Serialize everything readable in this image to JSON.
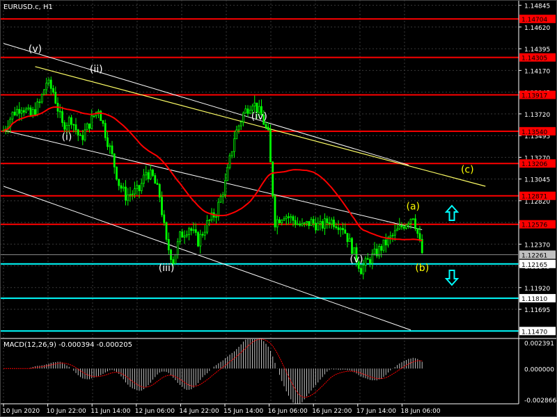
{
  "window": {
    "title": "EURUSD.c, H1"
  },
  "colors": {
    "background": "#000000",
    "grid": "#3a3a3a",
    "axis": "#ffffff",
    "bull_candle": "#00ff00",
    "bear_candle": "#00ff00",
    "support_line": "#ff0000",
    "support_label_bg": "#ff0000",
    "cyan_line": "#00ffff",
    "cyan_label_bg": "#ffffff",
    "ma": "#ff0000",
    "channel": "#ffffff",
    "trend": "#ffff66",
    "wave_white": "#ffffff",
    "wave_yellow": "#ffff00",
    "arrow": "#00ffff",
    "macd_hist": "#c0c0c0",
    "macd_signal": "#ff0000",
    "current_price_bg": "#c0c0c0"
  },
  "chart_data": [
    {
      "type": "candlestick",
      "title": "EURUSD.c, H1",
      "price_axis_ticks": [
        "1.14845",
        "1.14620",
        "1.14395",
        "1.14170",
        "1.13945",
        "1.13720",
        "1.13495",
        "1.13270",
        "1.13045",
        "1.12820",
        "1.12595",
        "1.12370",
        "1.12145",
        "1.11920",
        "1.11695"
      ],
      "ylim": [
        1.114,
        1.149
      ],
      "time_axis_ticks": [
        "10 Jun 2020",
        "10 Jun 22:00",
        "11 Jun 14:00",
        "12 Jun 06:00",
        "14 Jun 22:00",
        "15 Jun 14:00",
        "16 Jun 06:00",
        "16 Jun 22:00",
        "17 Jun 14:00",
        "18 Jun 06:00"
      ],
      "bar_count": 150,
      "close_path": [
        [
          0,
          1.1355
        ],
        [
          4,
          1.1372
        ],
        [
          8,
          1.138
        ],
        [
          12,
          1.137
        ],
        [
          16,
          1.1383
        ],
        [
          19,
          1.1405
        ],
        [
          22,
          1.1395
        ],
        [
          26,
          1.136
        ],
        [
          30,
          1.1367
        ],
        [
          34,
          1.1345
        ],
        [
          38,
          1.1362
        ],
        [
          42,
          1.1378
        ],
        [
          45,
          1.1352
        ],
        [
          48,
          1.1328
        ],
        [
          51,
          1.13
        ],
        [
          54,
          1.1287
        ],
        [
          57,
          1.129
        ],
        [
          60,
          1.1293
        ],
        [
          63,
          1.1312
        ],
        [
          66,
          1.1306
        ],
        [
          69,
          1.1287
        ],
        [
          72,
          1.1238
        ],
        [
          75,
          1.122
        ],
        [
          78,
          1.1245
        ],
        [
          82,
          1.1255
        ],
        [
          86,
          1.124
        ],
        [
          90,
          1.1258
        ],
        [
          94,
          1.127
        ],
        [
          98,
          1.13
        ],
        [
          102,
          1.1348
        ],
        [
          106,
          1.1372
        ],
        [
          110,
          1.1385
        ],
        [
          114,
          1.137
        ],
        [
          117,
          1.135
        ],
        [
          120,
          1.126
        ],
        [
          124,
          1.1268
        ],
        [
          128,
          1.1262
        ],
        [
          132,
          1.1255
        ],
        [
          136,
          1.126
        ],
        [
          140,
          1.1255
        ],
        [
          144,
          1.1262
        ],
        [
          148,
          1.1258
        ],
        [
          150,
          1.1255
        ]
      ],
      "horizontal_levels": [
        {
          "kind": "red",
          "value": 1.14704,
          "label": "1.14704"
        },
        {
          "kind": "red",
          "value": 1.14305,
          "label": "1.14305"
        },
        {
          "kind": "red",
          "value": 1.13917,
          "label": "1.13917"
        },
        {
          "kind": "red",
          "value": 1.1354,
          "label": "1.13540"
        },
        {
          "kind": "red",
          "value": 1.13206,
          "label": "1.13206"
        },
        {
          "kind": "red",
          "value": 1.12871,
          "label": "1.12871"
        },
        {
          "kind": "red",
          "value": 1.12576,
          "label": "1.12576"
        },
        {
          "kind": "cyan",
          "value": 1.12165,
          "label": "1.12165"
        },
        {
          "kind": "cyan",
          "value": 1.1181,
          "label": "1.11810"
        },
        {
          "kind": "cyan",
          "value": 1.1147,
          "label": "1.11470"
        }
      ],
      "current_price": {
        "value": 1.12261,
        "label": "1.12261"
      },
      "wave_labels": [
        {
          "text": "(v)",
          "color": "white",
          "bar": 14,
          "price": 1.1436
        },
        {
          "text": "(ii)",
          "color": "white",
          "bar": 41,
          "price": 1.1415
        },
        {
          "text": "(i)",
          "color": "white",
          "bar": 28,
          "price": 1.1345
        },
        {
          "text": "(iv)",
          "color": "white",
          "bar": 113,
          "price": 1.1366
        },
        {
          "text": "(iii)",
          "color": "white",
          "bar": 72,
          "price": 1.1209
        },
        {
          "text": "(v)",
          "color": "white",
          "bar": 156,
          "price": 1.1218
        },
        {
          "text": "(a)",
          "color": "yellow",
          "bar": 181,
          "price": 1.1273
        },
        {
          "text": "(b)",
          "color": "yellow",
          "bar": 185,
          "price": 1.1209
        },
        {
          "text": "(c)",
          "color": "yellow",
          "bar": 205,
          "price": 1.1311
        }
      ]
    },
    {
      "type": "bar",
      "title": "MACD(12,26,9) -0.000394 -0.000205",
      "axis_ticks": [
        "0.002391",
        "0.000000",
        "-0.002866"
      ],
      "ylim": [
        -0.002866,
        0.002391
      ],
      "signal_name": "signal"
    }
  ]
}
